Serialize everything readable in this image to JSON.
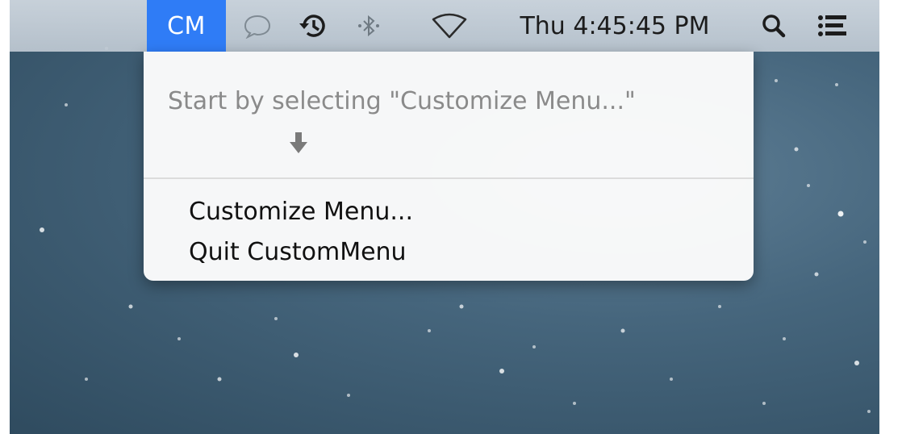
{
  "menubar": {
    "app_label": "CM",
    "clock": "Thu 4:45:45 PM",
    "icons": [
      "speech-bubble-icon",
      "time-machine-icon",
      "bluetooth-icon",
      "wifi-icon",
      "spotlight-search-icon",
      "notification-center-icon"
    ]
  },
  "menu": {
    "hint": "Start by selecting \"Customize Menu...\"",
    "hint_icon": "down-arrow-icon",
    "items": [
      {
        "label": "Customize Menu..."
      },
      {
        "label": "Quit CustomMenu"
      }
    ]
  },
  "colors": {
    "highlight": "#2f7cf6",
    "hint_text": "#8a8a8a",
    "menu_background": "#fcfcfc"
  }
}
